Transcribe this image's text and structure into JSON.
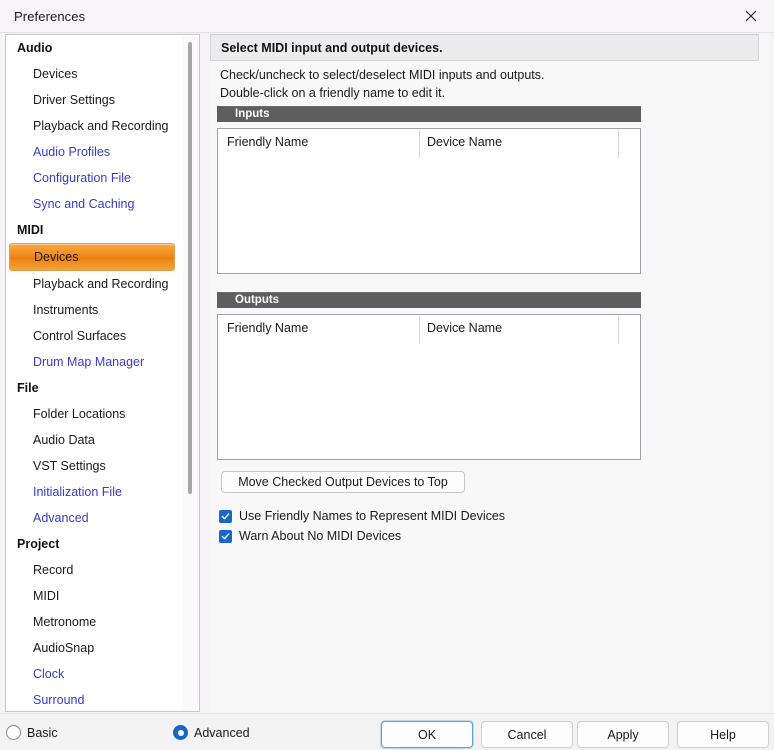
{
  "window": {
    "title": "Preferences",
    "close_icon": "close-icon"
  },
  "sidebar": {
    "groups": [
      {
        "label": "Audio",
        "items": [
          {
            "label": "Devices",
            "style": "plain",
            "selected": false
          },
          {
            "label": "Driver Settings",
            "style": "plain",
            "selected": false
          },
          {
            "label": "Playback and Recording",
            "style": "plain",
            "selected": false
          },
          {
            "label": "Audio Profiles",
            "style": "link",
            "selected": false
          },
          {
            "label": "Configuration File",
            "style": "link",
            "selected": false
          },
          {
            "label": "Sync and Caching",
            "style": "link",
            "selected": false
          }
        ]
      },
      {
        "label": "MIDI",
        "items": [
          {
            "label": "Devices",
            "style": "plain",
            "selected": true
          },
          {
            "label": "Playback and Recording",
            "style": "plain",
            "selected": false
          },
          {
            "label": "Instruments",
            "style": "plain",
            "selected": false
          },
          {
            "label": "Control Surfaces",
            "style": "plain",
            "selected": false
          },
          {
            "label": "Drum Map Manager",
            "style": "link",
            "selected": false
          }
        ]
      },
      {
        "label": "File",
        "items": [
          {
            "label": "Folder Locations",
            "style": "plain",
            "selected": false
          },
          {
            "label": "Audio Data",
            "style": "plain",
            "selected": false
          },
          {
            "label": "VST Settings",
            "style": "plain",
            "selected": false
          },
          {
            "label": "Initialization File",
            "style": "link",
            "selected": false
          },
          {
            "label": "Advanced",
            "style": "link",
            "selected": false
          }
        ]
      },
      {
        "label": "Project",
        "items": [
          {
            "label": "Record",
            "style": "plain",
            "selected": false
          },
          {
            "label": "MIDI",
            "style": "plain",
            "selected": false
          },
          {
            "label": "Metronome",
            "style": "plain",
            "selected": false
          },
          {
            "label": "AudioSnap",
            "style": "plain",
            "selected": false
          },
          {
            "label": "Clock",
            "style": "link",
            "selected": false
          },
          {
            "label": "Surround",
            "style": "link",
            "selected": false
          }
        ]
      }
    ],
    "selected_accent": "#ef8a1c",
    "link_color": "#3b3bc8"
  },
  "main": {
    "header": "Select MIDI input and output devices.",
    "description_line_1": "Check/uncheck to select/deselect MIDI inputs and outputs.",
    "description_line_2": "Double-click on a friendly name to edit it.",
    "inputs": {
      "section_title": "Inputs",
      "columns": [
        "Friendly Name",
        "Device Name"
      ],
      "rows": []
    },
    "outputs": {
      "section_title": "Outputs",
      "columns": [
        "Friendly Name",
        "Device Name"
      ],
      "rows": []
    },
    "move_button": "Move Checked Output Devices to Top",
    "checkboxes": [
      {
        "label": "Use Friendly Names to Represent MIDI Devices",
        "checked": true
      },
      {
        "label": "Warn About No MIDI Devices",
        "checked": true
      }
    ],
    "section_bar_color": "#5e5e5e"
  },
  "footer": {
    "radios": [
      {
        "label": "Basic",
        "checked": false
      },
      {
        "label": "Advanced",
        "checked": true
      }
    ],
    "buttons": [
      {
        "label": "OK",
        "default": true
      },
      {
        "label": "Cancel",
        "default": false
      },
      {
        "label": "Apply",
        "default": false
      },
      {
        "label": "Help",
        "default": false
      }
    ],
    "accent": "#1668c8"
  }
}
